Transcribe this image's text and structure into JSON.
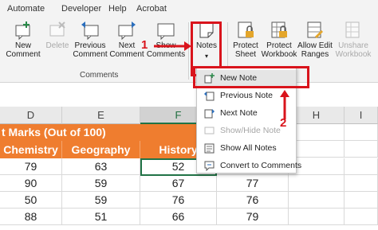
{
  "menubar": {
    "items": [
      "Automate",
      "Developer",
      "Help",
      "Acrobat"
    ]
  },
  "ribbon": {
    "comments": [
      {
        "label1": "New",
        "label2": "Comment",
        "icon": "new-comment-icon",
        "disabled": false
      },
      {
        "label1": "Delete",
        "label2": "",
        "icon": "delete-comment-icon",
        "disabled": true
      },
      {
        "label1": "Previous",
        "label2": "Comment",
        "icon": "previous-comment-icon",
        "disabled": false
      },
      {
        "label1": "Next",
        "label2": "Comment",
        "icon": "next-comment-icon",
        "disabled": false
      },
      {
        "label1": "Show",
        "label2": "Comments",
        "icon": "show-comments-icon",
        "disabled": false
      }
    ],
    "comments_group_label": "Comments",
    "notes_label": "Notes",
    "protect": [
      {
        "label1": "Protect",
        "label2": "Sheet",
        "icon": "protect-sheet-icon",
        "disabled": false
      },
      {
        "label1": "Protect",
        "label2": "Workbook",
        "icon": "protect-workbook-icon",
        "disabled": false
      },
      {
        "label1": "Allow Edit",
        "label2": "Ranges",
        "icon": "allow-edit-ranges-icon",
        "disabled": false
      },
      {
        "label1": "Unshare",
        "label2": "Workbook",
        "icon": "unshare-workbook-icon",
        "disabled": true
      }
    ]
  },
  "notes_menu": {
    "items": [
      {
        "label": "New Note",
        "icon": "new-note-icon",
        "disabled": false
      },
      {
        "label": "Previous Note",
        "icon": "previous-note-icon",
        "disabled": false
      },
      {
        "label": "Next Note",
        "icon": "next-note-icon",
        "disabled": false
      },
      {
        "label": "Show/Hide Note",
        "icon": "show-hide-note-icon",
        "disabled": true
      },
      {
        "label": "Show All Notes",
        "icon": "show-all-notes-icon",
        "disabled": false
      },
      {
        "label": "Convert to Comments",
        "icon": "convert-to-comments-icon",
        "disabled": false
      }
    ]
  },
  "callouts": {
    "one": "1",
    "two": "2"
  },
  "sheet": {
    "columns": [
      "D",
      "E",
      "F",
      "G",
      "H",
      "I"
    ],
    "title": "t Marks (Out of 100)",
    "headers": [
      "Chemistry",
      "Geography",
      "History"
    ],
    "rows": [
      [
        "79",
        "63",
        "52",
        ""
      ],
      [
        "90",
        "59",
        "67",
        "77"
      ],
      [
        "50",
        "59",
        "76",
        "76"
      ],
      [
        "88",
        "51",
        "66",
        "79"
      ]
    ]
  },
  "colors": {
    "accent": "#d9141c",
    "header_fill": "#ef7d2f",
    "excel_green": "#217346"
  }
}
